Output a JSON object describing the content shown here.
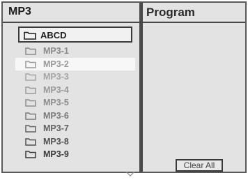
{
  "left_panel": {
    "title": "MP3",
    "current_folder": "ABCD",
    "items": [
      {
        "label": "MP3-1",
        "color": "#8a8a8a"
      },
      {
        "label": "MP3-2",
        "color": "#9a9a9a"
      },
      {
        "label": "MP3-3",
        "color": "#a6a6a6"
      },
      {
        "label": "MP3-4",
        "color": "#999999"
      },
      {
        "label": "MP3-5",
        "color": "#8c8c8c"
      },
      {
        "label": "MP3-6",
        "color": "#7b7b7b"
      },
      {
        "label": "MP3-7",
        "color": "#626262"
      },
      {
        "label": "MP3-8",
        "color": "#505050"
      },
      {
        "label": "MP3-9",
        "color": "#3a3a3a"
      }
    ],
    "highlighted_index": 1
  },
  "right_panel": {
    "title": "Program",
    "clear_all_label": "Clear All"
  },
  "colors": {
    "border": "#4a4a4a",
    "background": "#e3e3e3",
    "highlight": "#f7f7f7"
  },
  "icons": {
    "folder": "folder-icon",
    "scroll": "scroll-down-arrow-icon"
  }
}
